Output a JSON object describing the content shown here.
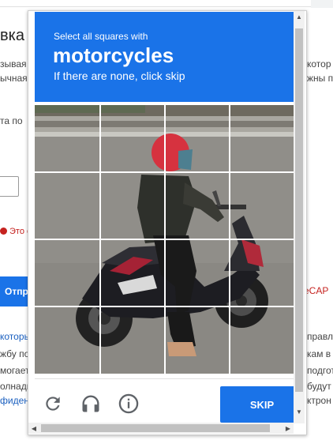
{
  "background_page": {
    "title_fragment": "вка -",
    "lines": [
      "зывая",
      "ычная.",
      "та по",
      "которы",
      "жбу по",
      "могает",
      "олнадк",
      "фиденц"
    ],
    "right_lines": [
      "котор",
      "жны по",
      "правля",
      "кам в",
      "подгот",
      "будут",
      "ктрон"
    ],
    "error_text": "Это с",
    "submit_label": "Отпр",
    "recaptcha_fragment": "eCAP"
  },
  "captcha": {
    "instruction": "Select all squares with",
    "target_object": "motorcycles",
    "sub_instruction": "If there are none, click skip",
    "grid": {
      "rows": 4,
      "cols": 4
    },
    "footer": {
      "reload_icon": "reload-icon",
      "audio_icon": "headphones-icon",
      "info_icon": "info-icon",
      "skip_label": "SKIP"
    }
  },
  "colors": {
    "accent": "#1a73e8",
    "error": "#c5221f",
    "link": "#1a5fbf"
  }
}
